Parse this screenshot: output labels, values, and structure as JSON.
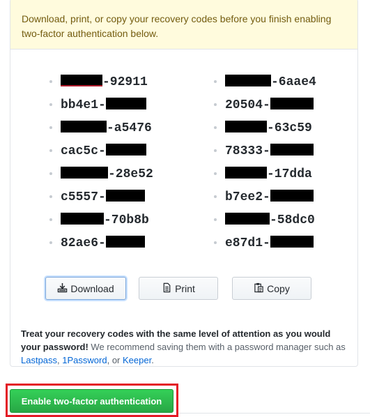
{
  "warning": {
    "text": "Download, print, or copy your recovery codes before you finish enabling two-factor authentication below."
  },
  "codes": {
    "left": [
      {
        "prefix": "",
        "suffix": "-92911"
      },
      {
        "prefix": "bb4e1-",
        "suffix": ""
      },
      {
        "prefix": "",
        "suffix": "-a5476"
      },
      {
        "prefix": "cac5c-",
        "suffix": ""
      },
      {
        "prefix": "",
        "suffix": "-28e52"
      },
      {
        "prefix": "c5557-",
        "suffix": ""
      },
      {
        "prefix": "",
        "suffix": "-70b8b"
      },
      {
        "prefix": "82ae6-",
        "suffix": ""
      }
    ],
    "right": [
      {
        "prefix": "",
        "suffix": "-6aae4"
      },
      {
        "prefix": "20504-",
        "suffix": ""
      },
      {
        "prefix": "",
        "suffix": "-63c59"
      },
      {
        "prefix": "78333-",
        "suffix": ""
      },
      {
        "prefix": "",
        "suffix": "-17dda"
      },
      {
        "prefix": "b7ee2-",
        "suffix": ""
      },
      {
        "prefix": "",
        "suffix": "-58dc0"
      },
      {
        "prefix": "e87d1-",
        "suffix": ""
      }
    ]
  },
  "actions": {
    "download_label": "Download",
    "print_label": "Print",
    "copy_label": "Copy"
  },
  "note": {
    "bold": "Treat your recovery codes with the same level of attention as you would your password!",
    "text": " We recommend saving them with a password manager such as ",
    "link1": "Lastpass",
    "sep1": ", ",
    "link2": "1Password",
    "sep2": ", or ",
    "link3": "Keeper",
    "end": "."
  },
  "submit": {
    "label": "Enable two-factor authentication"
  },
  "colors": {
    "warning_bg": "#fffbdd",
    "primary_green": "#28a745",
    "link_blue": "#0366d6",
    "highlight_red": "#e31a26"
  }
}
